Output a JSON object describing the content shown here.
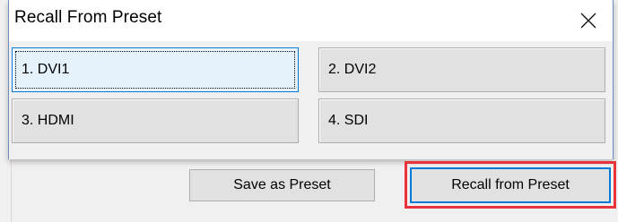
{
  "dialog": {
    "title": "Recall From Preset",
    "close_icon": "close-icon",
    "presets": [
      {
        "label": "1. DVI1"
      },
      {
        "label": "2. DVI2"
      },
      {
        "label": "3. HDMI"
      },
      {
        "label": "4. SDI"
      }
    ]
  },
  "parent": {
    "save_label": "Save as Preset",
    "recall_label": "Recall from Preset"
  },
  "colors": {
    "accent": "#0078d7",
    "highlight": "#e8333a"
  }
}
